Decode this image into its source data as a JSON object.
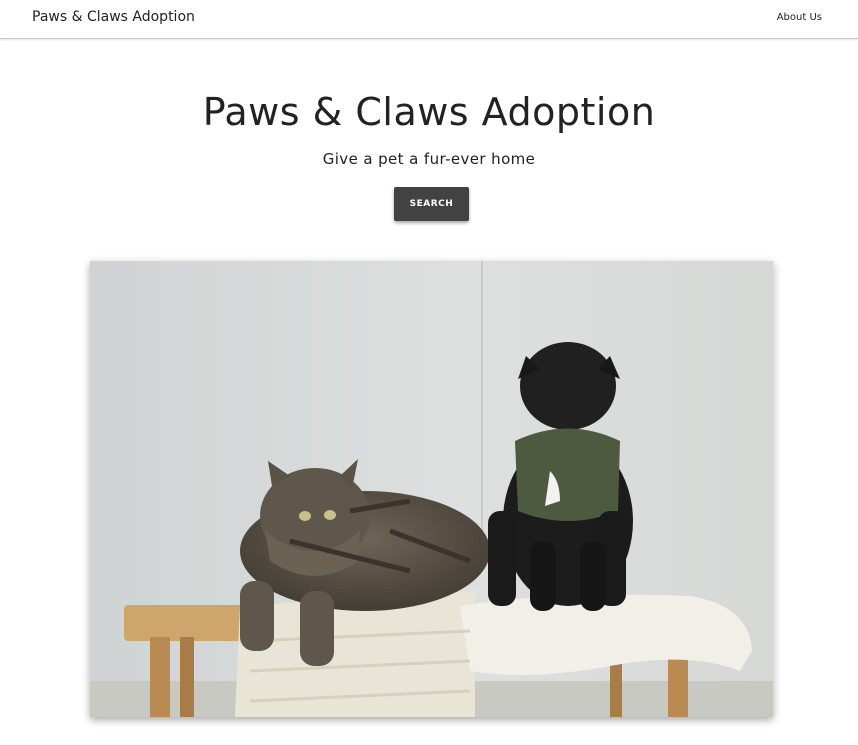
{
  "navbar": {
    "brand": "Paws & Claws Adoption",
    "links": [
      {
        "label": "About Us"
      }
    ]
  },
  "hero": {
    "title": "Paws & Claws Adoption",
    "subtitle": "Give a pet a fur-ever home",
    "button_label": "SEARCH"
  },
  "photo": {
    "subject": "tabby-cat-and-black-pug-on-bench",
    "colors": {
      "wall": "#dcdfdd",
      "cat": "#5b5348",
      "pug": "#1b1b1b",
      "harness": "#4e5a40",
      "towel": "#ece8dc",
      "bench": "#c9a06a"
    }
  },
  "colors": {
    "button_bg": "#424242",
    "button_text": "#ffffff",
    "navbar_border": "#c8c8c8"
  }
}
